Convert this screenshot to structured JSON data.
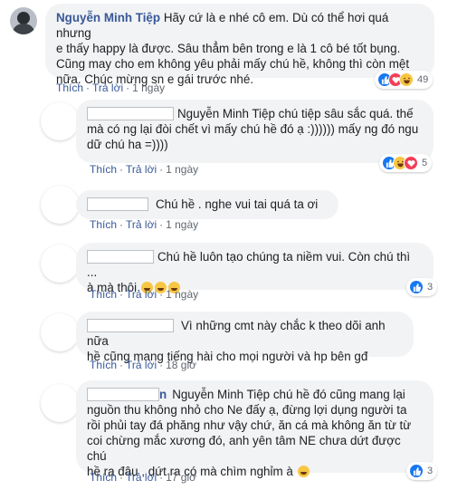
{
  "main_comment": {
    "author": "Nguyễn Minh Tiệp",
    "text_line1": "Hãy cứ là e nhé cô em. Dù có thể hơi quá nhưng",
    "text_line2": "e thấy happy là được. Sâu thẳm bên trong e là 1 cô bé tốt bụng.",
    "text_line3": "Cũng may cho em không yêu phải mấy chú hề, không thì còn mệt",
    "text_line4": "nữa. Chúc mừng sn e gái trước nhé.",
    "like_label": "Thích",
    "reply_label": "Trả lời",
    "time": "1 ngày",
    "reaction_count": "49"
  },
  "replies": [
    {
      "mention": "Nguyễn Minh Tiệp",
      "text_line1": " chú tiệp sâu sắc quá. thế",
      "text_line2": "mà có ng lại đòi chết vì mấy chú hề đó ạ :)))))) mấy ng đó ngu",
      "text_line3": "dữ chú ha =))))",
      "like_label": "Thích",
      "reply_label": "Trả lời",
      "time": "1 ngày",
      "reaction_count": "5"
    },
    {
      "text_line1": "Chú hề . nghe vui tai quá ta ơi",
      "like_label": "Thích",
      "reply_label": "Trả lời",
      "time": "1 ngày"
    },
    {
      "text_line1": "Chú hề luôn tạo chúng ta niềm vui. Còn chú thì ...",
      "text_line2": "à mà thôi",
      "like_label": "Thích",
      "reply_label": "Trả lời",
      "time": "1 ngày",
      "reaction_count": "3"
    },
    {
      "text_line1": "Vì những cmt này chắc k theo dõi anh nữa",
      "text_line2": "hề cũng mang tiếng hài cho mọi người và hp bên gđ",
      "like_label": "Thích",
      "reply_label": "Trả lời",
      "time": "18 giờ"
    },
    {
      "name_tail": "n",
      "mention": "Nguyễn Minh Tiệp",
      "text_line1": " chú hề đó cũng mang lại",
      "text_line2": "nguồn thu không nhỏ cho Ne đấy ạ, đừng lợi dụng người ta",
      "text_line3": "rồi phủi tay đá phăng như vậy chứ, ăn cá mà không ăn từ từ",
      "text_line4": "coi chừng mắc xương đó, anh yên tâm NE chưa dứt được chú",
      "text_line5": "hề ra đâu , dứt ra có mà chìm nghỉm à",
      "like_label": "Thích",
      "reply_label": "Trả lời",
      "time": "17 giờ",
      "reaction_count": "3"
    }
  ],
  "icons": {
    "like": "thumbs-up-icon",
    "love": "heart-icon",
    "haha": "laughing-face-icon",
    "emoji": "smiling-face-emoji"
  },
  "colors": {
    "link": "#385898",
    "bubble": "#f2f3f5",
    "like": "#1877f2",
    "love": "#f33e58",
    "haha": "#f7c643"
  }
}
